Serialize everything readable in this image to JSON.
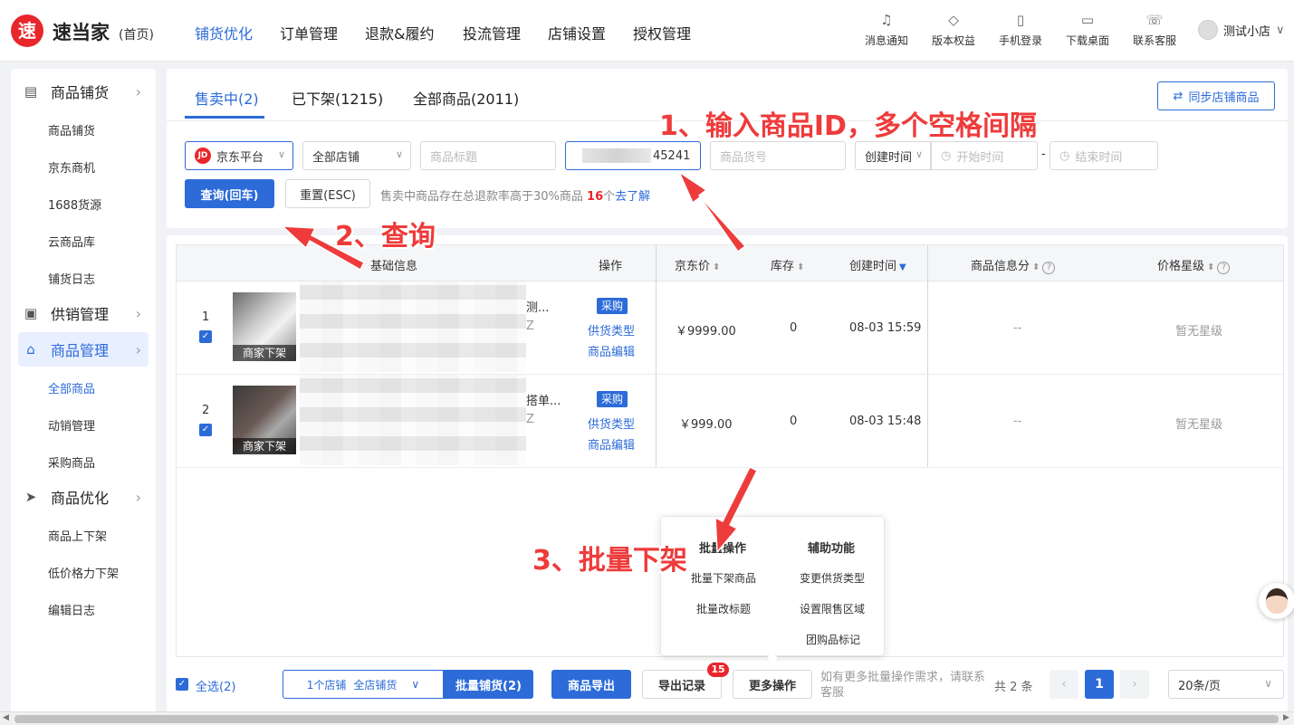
{
  "header": {
    "logo_text": "速",
    "brand": "速当家",
    "brand_sub": "(首页)",
    "nav": [
      "铺货优化",
      "订单管理",
      "退款&履约",
      "投流管理",
      "店铺设置",
      "授权管理"
    ],
    "tools": [
      {
        "label": "消息通知",
        "icon": "bell-icon",
        "glyph": "♫"
      },
      {
        "label": "版本权益",
        "icon": "diamond-icon",
        "glyph": "◇"
      },
      {
        "label": "手机登录",
        "icon": "phone-icon",
        "glyph": "▯"
      },
      {
        "label": "下载桌面",
        "icon": "monitor-icon",
        "glyph": "▭"
      },
      {
        "label": "联系客服",
        "icon": "headset-icon",
        "glyph": "☏"
      }
    ],
    "user_name": "测试小店",
    "user_caret": "∨"
  },
  "sidebar": {
    "groups": [
      {
        "label": "商品铺货",
        "icon": "box-icon",
        "glyph": "▤",
        "items": [
          "商品铺货",
          "京东商机",
          "1688货源",
          "云商品库",
          "铺货日志"
        ]
      },
      {
        "label": "供销管理",
        "icon": "calendar-icon",
        "glyph": "▣",
        "items": []
      },
      {
        "label": "商品管理",
        "icon": "bag-icon",
        "glyph": "⌂",
        "items": [
          "全部商品",
          "动销管理",
          "采购商品"
        ]
      },
      {
        "label": "商品优化",
        "icon": "send-icon",
        "glyph": "➤",
        "items": [
          "商品上下架",
          "低价格力下架",
          "编辑日志"
        ]
      }
    ],
    "arrow": "›"
  },
  "tabs": [
    "售卖中(2)",
    "已下架(1215)",
    "全部商品(2011)"
  ],
  "sync_button": "同步店铺商品",
  "sync_glyph": "⇄",
  "filters": {
    "platform": "京东平台",
    "jd_badge": "JD",
    "shop": "全部店铺",
    "title_placeholder": "商品标题",
    "id_value": "45241",
    "sku_placeholder": "商品货号",
    "time_type": "创建时间",
    "start_placeholder": "开始时间",
    "end_placeholder": "结束时间",
    "range_sep": "-",
    "clock_glyph": "◷",
    "caret": "∨"
  },
  "buttons": {
    "query": "查询(回车)",
    "reset": "重置(ESC)"
  },
  "notice": {
    "text": "售卖中商品存在总退款率高于30%商品",
    "count": "16",
    "unit": "个",
    "link": "去了解"
  },
  "table": {
    "headers": {
      "basic": "基础信息",
      "ops": "操作",
      "price": "京东价",
      "stock": "库存",
      "created": "创建时间",
      "score": "商品信息分",
      "rating": "价格星级"
    },
    "sort_glyph": "⬍",
    "sort_desc_glyph": "▼",
    "help_glyph": "?",
    "check_glyph": "✓",
    "rows": [
      {
        "num": "1",
        "badge": "商家下架",
        "title_tail": "测...",
        "tail2": "Z",
        "tag": "采购",
        "link1": "供货类型",
        "link2": "商品编辑",
        "price": "￥9999.00",
        "stock": "0",
        "created": "08-03 15:59",
        "score": "--",
        "rating": "暂无星级"
      },
      {
        "num": "2",
        "badge": "商家下架",
        "title_tail": "搭单...",
        "tail2": "Z",
        "tag": "采购",
        "link1": "供货类型",
        "link2": "商品编辑",
        "price": "￥999.00",
        "stock": "0",
        "created": "08-03 15:48",
        "score": "--",
        "rating": "暂无星级"
      }
    ]
  },
  "popup": {
    "left_header": "批量操作",
    "left_items": [
      "批量下架商品",
      "批量改标题"
    ],
    "right_header": "辅助功能",
    "right_items": [
      "变更供货类型",
      "设置限售区域",
      "团购品标记"
    ]
  },
  "footer": {
    "select_all": "全选(2)",
    "shop_count": "1个店铺",
    "all_shops": "全店铺货",
    "batch_publish": "批量铺货(2)",
    "export": "商品导出",
    "export_log": "导出记录",
    "export_badge": "15",
    "more_ops": "更多操作",
    "hint": "如有更多批量操作需求，请联系客服",
    "total": "共 2 条",
    "prev": "‹",
    "page": "1",
    "next": "›",
    "page_size": "20条/页"
  },
  "scroll_arrows": {
    "left": "◀",
    "right": "▶"
  },
  "annotations": {
    "a1": "1、输入商品ID，多个空格间隔",
    "a2": "2、查询",
    "a3": "3、批量下架"
  },
  "colors": {
    "accent": "#2c6bd8",
    "brand_red": "#e8262b",
    "annotation": "#ee3b3b"
  }
}
